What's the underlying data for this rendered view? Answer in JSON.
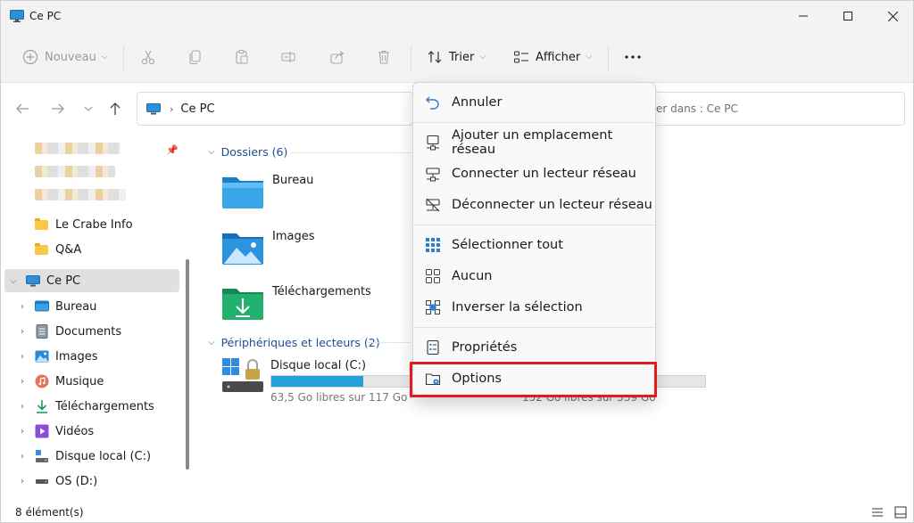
{
  "window": {
    "title": "Ce PC"
  },
  "commandbar": {
    "new_label": "Nouveau",
    "sort_label": "Trier",
    "view_label": "Afficher",
    "more_label": "..."
  },
  "address": {
    "crumb": "Ce PC",
    "search_placeholder": "er dans : Ce PC"
  },
  "sidebar": {
    "quick_items": [
      {
        "label": "Le Crabe Info"
      },
      {
        "label": "Q&A"
      }
    ],
    "this_pc": "Ce PC",
    "children": [
      {
        "label": "Bureau",
        "icon": "desktop-icon"
      },
      {
        "label": "Documents",
        "icon": "documents-icon"
      },
      {
        "label": "Images",
        "icon": "pictures-icon"
      },
      {
        "label": "Musique",
        "icon": "music-icon"
      },
      {
        "label": "Téléchargements",
        "icon": "downloads-icon"
      },
      {
        "label": "Vidéos",
        "icon": "videos-icon"
      },
      {
        "label": "Disque local (C:)",
        "icon": "drive-icon"
      },
      {
        "label": "OS (D:)",
        "icon": "drive-icon"
      }
    ]
  },
  "content": {
    "folders_header": "Dossiers (6)",
    "folders": [
      {
        "label": "Bureau"
      },
      {
        "label": "Images"
      },
      {
        "label": "Téléchargements"
      }
    ],
    "devices_header": "Périphériques et lecteurs (2)",
    "drives": [
      {
        "label": "Disque local (C:)",
        "free_text": "63,5 Go libres sur 117 Go",
        "used_fraction": 0.46
      },
      {
        "label": "",
        "free_text": "152 Go libres sur 339 Go",
        "used_fraction": 0.55
      }
    ]
  },
  "menu": {
    "items": [
      {
        "label": "Annuler",
        "icon": "undo-icon"
      },
      {
        "label": "Ajouter un emplacement réseau",
        "icon": "network-location-icon"
      },
      {
        "label": "Connecter un lecteur réseau",
        "icon": "map-drive-icon"
      },
      {
        "label": "Déconnecter un lecteur réseau",
        "icon": "disconnect-drive-icon"
      },
      {
        "label": "Sélectionner tout",
        "icon": "select-all-icon"
      },
      {
        "label": "Aucun",
        "icon": "select-none-icon"
      },
      {
        "label": "Inverser la sélection",
        "icon": "invert-selection-icon"
      },
      {
        "label": "Propriétés",
        "icon": "properties-icon"
      },
      {
        "label": "Options",
        "icon": "options-icon"
      }
    ]
  },
  "statusbar": {
    "count": "8 élément(s)"
  },
  "colors": {
    "accent": "#26a0da",
    "folder_header": "#1b4f91",
    "highlight": "#e21b1b"
  }
}
